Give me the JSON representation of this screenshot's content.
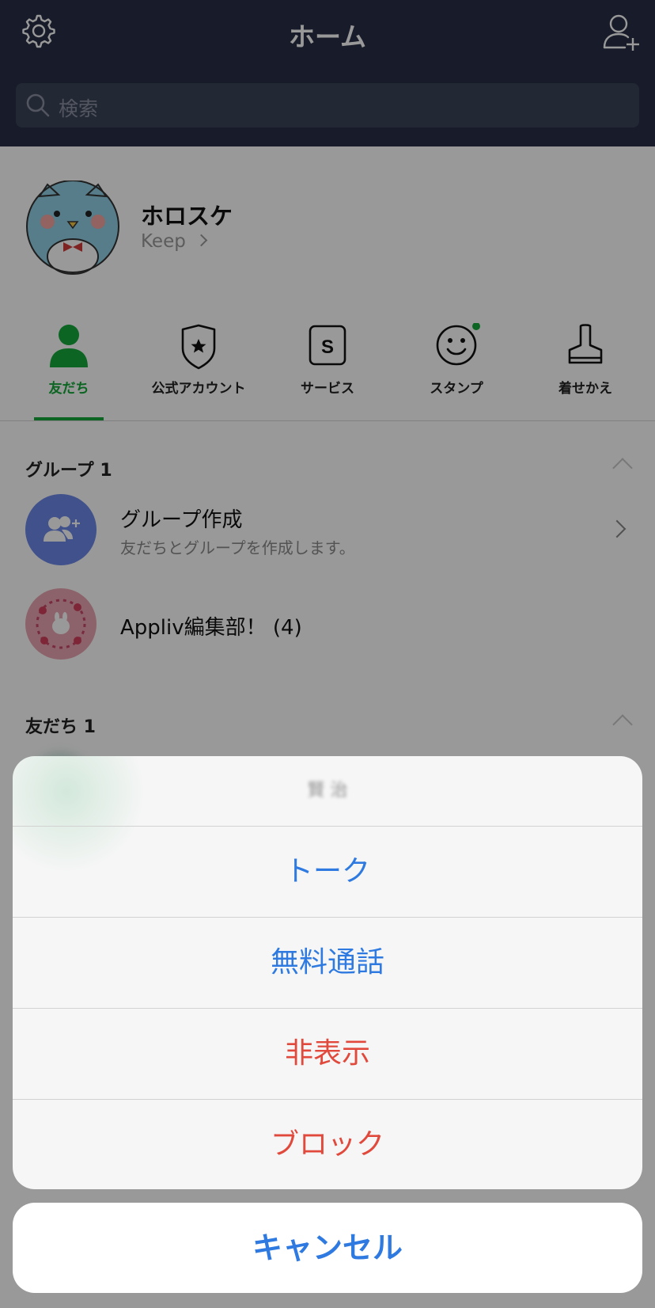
{
  "header": {
    "title": "ホーム",
    "search_placeholder": "検索"
  },
  "profile": {
    "name": "ホロスケ",
    "keep_label": "Keep"
  },
  "tabs": [
    {
      "label": "友だち",
      "icon": "person-icon",
      "active": true
    },
    {
      "label": "公式アカウント",
      "icon": "shield-star-icon"
    },
    {
      "label": "サービス",
      "icon": "service-s-icon"
    },
    {
      "label": "スタンプ",
      "icon": "smiley-icon",
      "badge": true
    },
    {
      "label": "着せかえ",
      "icon": "brush-icon"
    }
  ],
  "groups_section": {
    "title": "グループ 1",
    "create": {
      "title": "グループ作成",
      "subtitle": "友だちとグループを作成します。"
    },
    "items": [
      {
        "name": "Appliv編集部！ (4)"
      }
    ]
  },
  "friends_section": {
    "title": "友だち 1"
  },
  "action_sheet": {
    "title": "賢 治",
    "options": [
      {
        "label": "トーク",
        "style": "default"
      },
      {
        "label": "無料通話",
        "style": "default"
      },
      {
        "label": "非表示",
        "style": "destructive"
      },
      {
        "label": "ブロック",
        "style": "destructive"
      }
    ],
    "cancel_label": "キャンセル"
  },
  "colors": {
    "header_bg": "#283046",
    "accent_green": "#15a83a",
    "ios_blue": "#2e7ae0",
    "destructive_red": "#e0493c",
    "group_create_circle": "#6b87e8"
  }
}
